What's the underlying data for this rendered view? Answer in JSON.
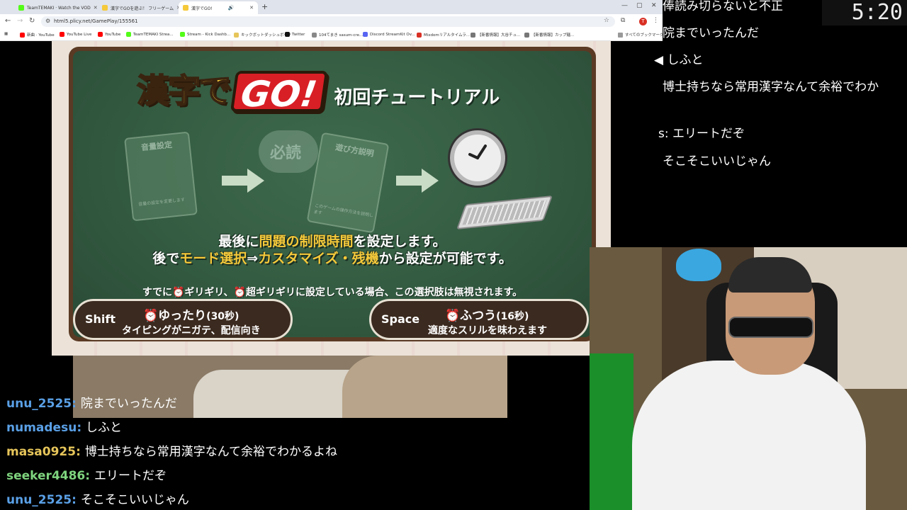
{
  "browser": {
    "tabs": [
      {
        "label": "TeamTEMAKI · Watch the VOD",
        "fav_color": "#53fc18",
        "active": false
      },
      {
        "label": "漢字でGOを遊ぶ！ フリーゲーム",
        "fav_color": "#f5c93a",
        "active": false
      },
      {
        "label": "漢字でGO!",
        "fav_color": "#f5c93a",
        "active": true
      }
    ],
    "new_tab": "+",
    "url": "html5.plicy.net/GamePlay/155561",
    "profile_initial": "T",
    "bookmarks": [
      {
        "label": "新曲 · YouTube",
        "fav_color": "#ff0000"
      },
      {
        "label": "YouTube Live",
        "fav_color": "#ff0000"
      },
      {
        "label": "YouTube",
        "fav_color": "#ff0000"
      },
      {
        "label": "TeamTEMAKI Strea...",
        "fav_color": "#53fc18"
      },
      {
        "label": "Stream - Kick Dashb...",
        "fav_color": "#53fc18"
      },
      {
        "label": "キックボットダッシュボード",
        "fav_color": "#e6c55a"
      },
      {
        "label": "Twitter",
        "fav_color": "#111111"
      },
      {
        "label": "104てまき sasum-cre...",
        "fav_color": "#888888"
      },
      {
        "label": "Discord StreamKit Ov...",
        "fav_color": "#5865f2"
      },
      {
        "label": "Mixdomリアルタイムラ...",
        "fav_color": "#d93025"
      },
      {
        "label": "【新番情報】大谷チュ...",
        "fav_color": "#777777"
      },
      {
        "label": "【新番情報】カップ麺...",
        "fav_color": "#777777"
      },
      {
        "label": "すべてのブックマーク",
        "fav_color": "#777777"
      }
    ]
  },
  "game": {
    "title_kanji": "漢字で",
    "title_go": "GO!",
    "title_sub": "初回チュートリアル",
    "card1_label": "音量設定",
    "card1_small": "音量の設定を変更します",
    "cloud_text": "必読",
    "card2_label": "遊び方説明",
    "card2_small": "このゲームの操作方法を説明します",
    "instr1_pre": "最後に",
    "instr1_hl": "問題の制限時間",
    "instr1_post": "を設定します。",
    "instr2_pre": "後で",
    "instr2_hl1": "モード選択",
    "instr2_mid": "⇒",
    "instr2_hl2": "カスタマイズ・残機",
    "instr2_post": "から設定が可能です。",
    "note": "すでに⏰ギリギリ、⏰超ギリギリに設定している場合、この選択肢は無視されます。",
    "options": {
      "shift": {
        "key": "Shift",
        "title": "⏰ゆったり",
        "seconds": "(30秒)",
        "desc": "タイピングがニガテ、配信向き"
      },
      "space": {
        "key": "Space",
        "title": "⏰ふつう",
        "seconds": "(16秒)",
        "desc": "適度なスリルを味わえます"
      }
    }
  },
  "overlay": {
    "timer": "5:20",
    "right_chat": [
      "俸読み切らないと不正",
      "院までいったんだ",
      "◀ しふと",
      "博士持ちなら常用漢字なんて余裕でわか",
      "s: エリートだぞ",
      "そこそこいいじゃん"
    ]
  },
  "chat": [
    {
      "user": "unu_2525",
      "message": "院までいったんだ",
      "color": "#5aa0e6"
    },
    {
      "user": "numadesu",
      "message": "しふと",
      "color": "#5aa0e6"
    },
    {
      "user": "masa0925",
      "message": "博士持ちなら常用漢字なんて余裕でわかるよね",
      "color": "#e6c55a"
    },
    {
      "user": "seeker4486",
      "message": "エリートだぞ",
      "color": "#7ed37e"
    },
    {
      "user": "unu_2525",
      "message": "そこそこいいじゃん",
      "color": "#5aa0e6"
    }
  ]
}
